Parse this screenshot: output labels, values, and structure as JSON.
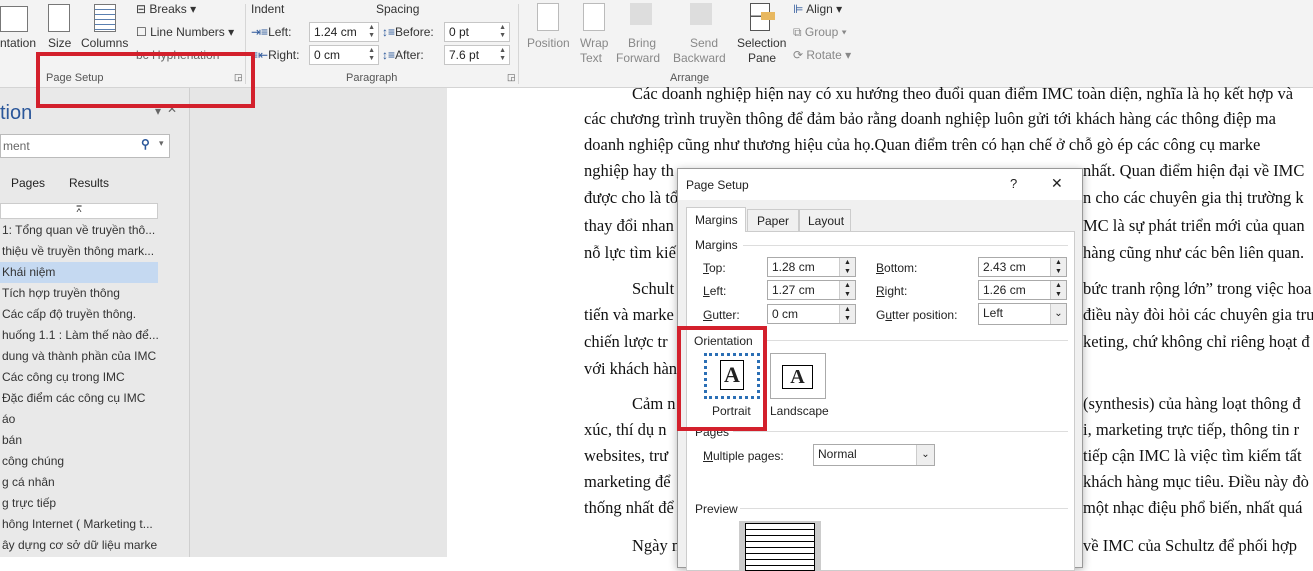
{
  "ribbon": {
    "orientation": "ntation",
    "size": "Size",
    "columns": "Columns",
    "breaks": "Breaks",
    "line_numbers": "Line Numbers",
    "hyphenation": "Hyphenation",
    "page_setup_group": "Page Setup",
    "indent": "Indent",
    "spacing": "Spacing",
    "left_label": "Left:",
    "right_label": "Right:",
    "before_label": "Before:",
    "after_label": "After:",
    "indent_left": "1.24 cm",
    "indent_right": "0 cm",
    "spacing_before": "0 pt",
    "spacing_after": "7.6 pt",
    "paragraph_group": "Paragraph",
    "position": "Position",
    "wrap": "Wrap",
    "wrap2": "Text",
    "bring": "Bring",
    "bring2": "Forward",
    "send": "Send",
    "send2": "Backward",
    "selection": "Selection",
    "selection2": "Pane",
    "align": "Align",
    "group": "Group",
    "rotate": "Rotate",
    "arrange_group": "Arrange"
  },
  "nav": {
    "title": "tion",
    "search_placeholder": "ment",
    "tab_pages": "Pages",
    "tab_results": "Results",
    "items": [
      "1: Tổng quan về truyền thô...",
      "thiệu về truyền thông mark...",
      "Khái niệm",
      "Tích hợp truyền thông",
      "Các cấp độ truyền thông.",
      "huống 1.1 : Làm thế nào để...",
      "dung và thành phần của IMC",
      "Các công cụ trong IMC",
      "Đặc điểm các công cụ IMC",
      "áo",
      "bán",
      "công chúng",
      "g cá nhân",
      "g trực tiếp",
      "hông Internet ( Marketing t...",
      "ây dựng cơ sở dữ liệu marke..."
    ],
    "selected_index": 2
  },
  "doc": {
    "lines": [
      {
        "l": "Các doanh nghiệp hiện nay có xu hướng theo đuổi quan điểm IMC toàn diện, nghĩa là họ kết hợp và",
        "r": "",
        "indent": true
      },
      {
        "l": "các chương trình truyền thông để đảm bảo rằng doanh nghiệp luôn gửi tới khách hàng các thông điệp ma",
        "r": ""
      },
      {
        "l": "doanh nghiệp cũng như thương hiệu của họ.Quan điểm trên có hạn chế ở chỗ gò ép các công cụ marke",
        "r": ""
      },
      {
        "l": "nghiệp hay th",
        "r": "nhất. Quan điểm hiện đại về IMC"
      },
      {
        "l": "được cho là tổ",
        "r": "n cho các chuyên gia thị trường k"
      },
      {
        "l": "thay đổi nhan",
        "r": "MC là sự phát triển mới của quan"
      },
      {
        "l": "nỗ lực tìm kiế",
        "r": "hàng cũng như các bên liên quan."
      },
      {
        "l": "Schult",
        "r": "bức tranh rộng lớn” trong việc hoa",
        "indent": true
      },
      {
        "l": "tiến và marke",
        "r": "điều này đòi hỏi các chuyên gia tru"
      },
      {
        "l": "chiến lược tr",
        "r": "keting, chứ không chỉ riêng hoạt đ"
      },
      {
        "l": "với khách hàn",
        "r": ""
      },
      {
        "l": "Cảm n",
        "r": "(synthesis) của hàng loạt thông đ",
        "indent": true
      },
      {
        "l": "xúc, thí dụ n",
        "r": "i, marketing trực tiếp, thông tin r"
      },
      {
        "l": "websites, trư",
        "r": "tiếp cận IMC là việc tìm kiếm tất"
      },
      {
        "l": "marketing để",
        "r": "khách hàng mục tiêu. Điều này đò"
      },
      {
        "l": "thống nhất để",
        "r": "một nhạc điệu phổ biến, nhất quá"
      },
      {
        "l": "Ngày n",
        "r": "về IMC của Schultz để phối hợp",
        "indent": true
      }
    ]
  },
  "dialog": {
    "title": "Page Setup",
    "help": "?",
    "close": "✕",
    "tabs": [
      "Margins",
      "Paper",
      "Layout"
    ],
    "active_tab": "Margins",
    "margins_section": "Margins",
    "top_label": "Top:",
    "bottom_label": "Bottom:",
    "left_label": "Left:",
    "right_label": "Right:",
    "gutter_label": "Gutter:",
    "gutter_pos_label": "Gutter position:",
    "top": "1.28 cm",
    "bottom": "2.43 cm",
    "left": "1.27 cm",
    "right": "1.26 cm",
    "gutter": "0 cm",
    "gutter_position": "Left",
    "orientation_section": "Orientation",
    "portrait": "Portrait",
    "landscape": "Landscape",
    "selected_orientation": "Portrait",
    "pages_section": "Pages",
    "multiple_pages_label": "Multiple pages:",
    "multiple_pages": "Normal",
    "preview_section": "Preview"
  },
  "colors": {
    "highlight": "#d3202c",
    "nav_selected": "#c5d9f1",
    "accent": "#2b579a"
  }
}
